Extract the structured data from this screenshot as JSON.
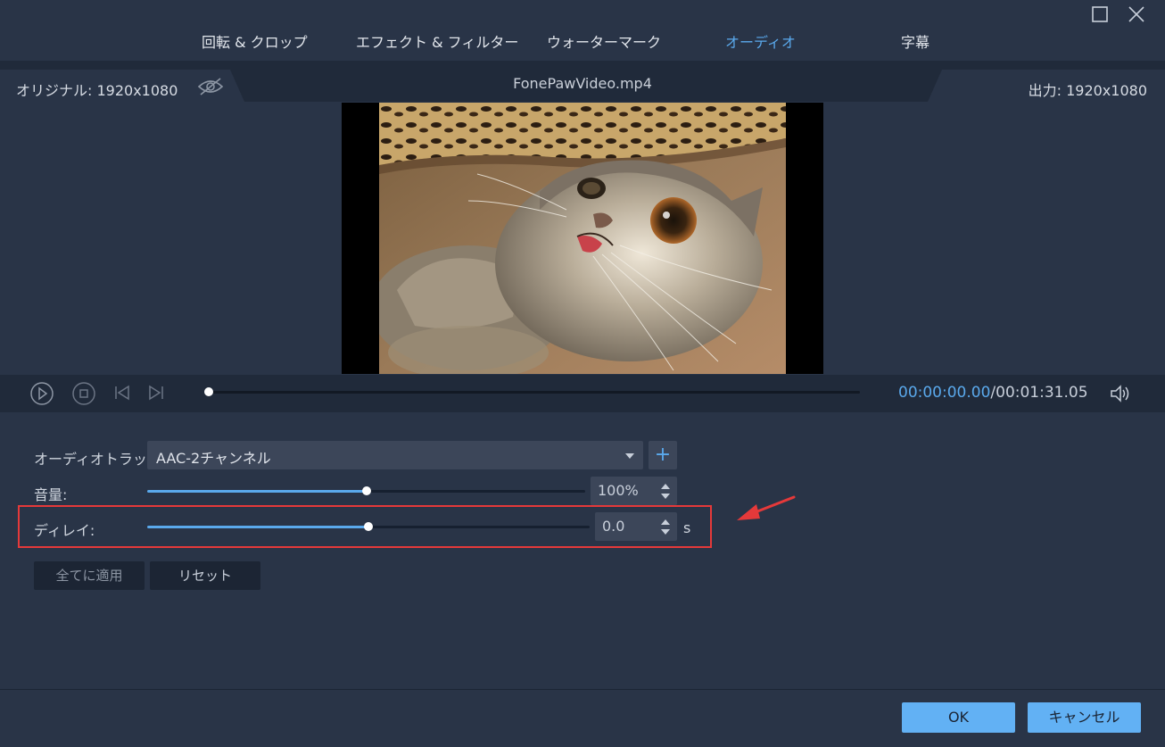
{
  "tabs": [
    {
      "label": "回転 & クロップ",
      "active": false
    },
    {
      "label": "エフェクト & フィルター",
      "active": false
    },
    {
      "label": "ウォーターマーク",
      "active": false
    },
    {
      "label": "オーディオ",
      "active": true
    },
    {
      "label": "字幕",
      "active": false
    }
  ],
  "window": {
    "maximize_icon": "maximize-icon",
    "close_icon": "close-icon"
  },
  "info": {
    "original": "オリジナル: 1920x1080",
    "filename": "FonePawVideo.mp4",
    "output": "出力: 1920x1080",
    "eye_icon": "eye-slash-icon"
  },
  "playback": {
    "current": "00:00:00.00",
    "separator": "/",
    "total": "00:01:31.05",
    "progress": 0,
    "icons": [
      "play-icon",
      "stop-icon",
      "prev-frame-icon",
      "next-frame-icon",
      "volume-icon"
    ]
  },
  "audio": {
    "track_label": "オーディオトラック:",
    "track_value": "AAC-2チャンネル",
    "add_label": "+",
    "volume_label": "音量:",
    "volume_value": "100%",
    "volume_level": 0.5,
    "delay_label": "ディレイ:",
    "delay_value": "0.0",
    "delay_unit": "s",
    "delay_level": 0.5
  },
  "actions": {
    "apply_all": "全てに適用",
    "reset": "リセット",
    "ok": "OK",
    "cancel": "キャンセル"
  },
  "colors": {
    "accent": "#5aa9ec",
    "highlight": "#e5393a",
    "background": "#293447"
  }
}
